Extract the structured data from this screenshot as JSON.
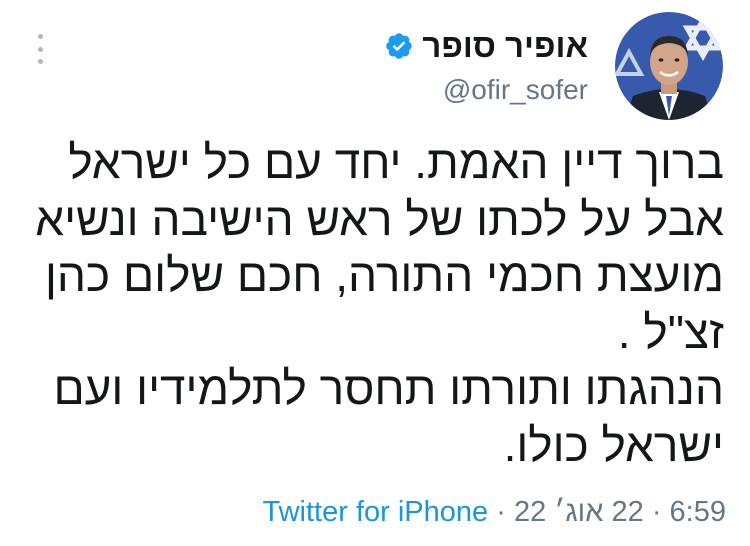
{
  "author": {
    "display_name": "אופיר סופר",
    "handle": "@ofir_sofer",
    "verified_color": "#1d9bf0"
  },
  "tweet": {
    "lines": [
      "ברוך דיין האמת. יחד עם כל ישראל",
      "אבל על לכתו של ראש הישיבה ונשיא",
      "מועצת חכמי התורה, חכם שלום כהן",
      "זצ\"ל .",
      "הנהגתו ותורתו תחסר לתלמידיו ועם",
      "ישראל כולו."
    ]
  },
  "meta": {
    "time": "6:59",
    "separator": "·",
    "date": "22 אוג׳ 22",
    "source": "Twitter for iPhone"
  },
  "icons": {
    "more": "vertical-ellipsis-icon",
    "verified": "verified-badge-icon"
  }
}
